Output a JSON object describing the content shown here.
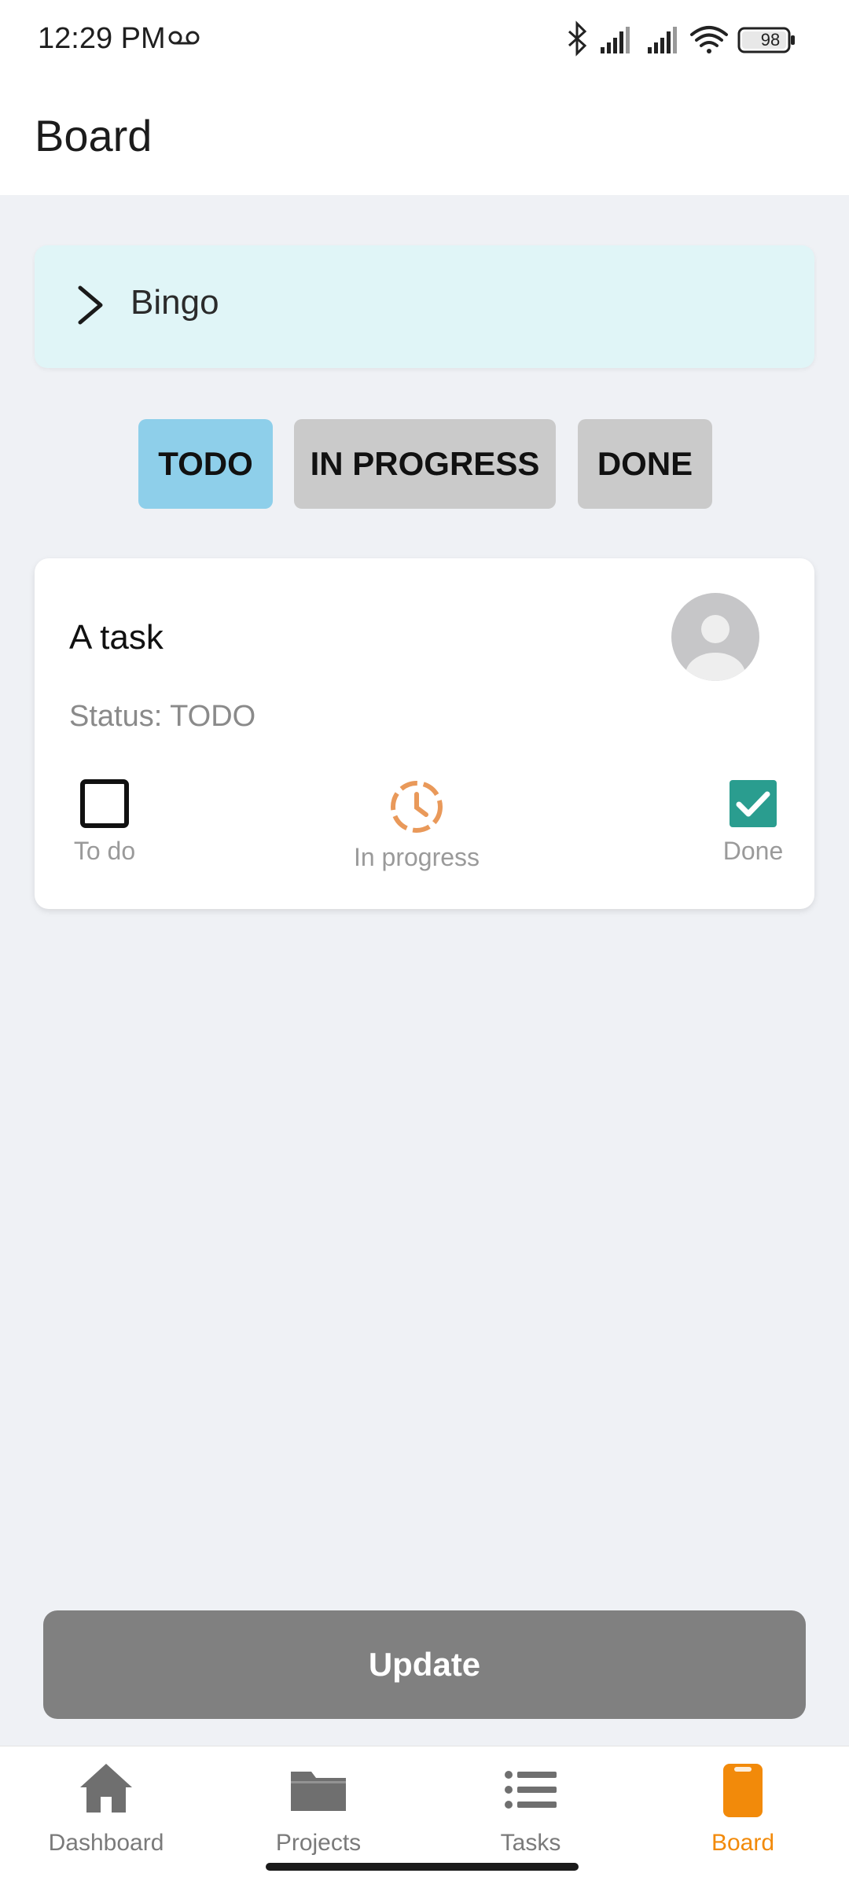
{
  "status_bar": {
    "time": "12:29 PM",
    "battery": "98",
    "icons": [
      "voicemail-icon",
      "bluetooth-icon",
      "signal-icon",
      "signal-icon",
      "wifi-icon",
      "battery-icon"
    ]
  },
  "app_bar": {
    "title": "Board"
  },
  "project": {
    "name": "Bingo",
    "icon": "chevron-right-icon"
  },
  "tabs": [
    {
      "label": "TODO",
      "selected": true
    },
    {
      "label": "IN PROGRESS",
      "selected": false
    },
    {
      "label": "DONE",
      "selected": false
    }
  ],
  "task": {
    "title": "A task",
    "status_text": "Status: TODO",
    "states": [
      {
        "label": "To do",
        "icon": "empty-checkbox-icon"
      },
      {
        "label": "In progress",
        "icon": "clock-icon"
      },
      {
        "label": "Done",
        "icon": "checked-checkbox-icon"
      }
    ]
  },
  "update_button": {
    "label": "Update"
  },
  "nav": [
    {
      "label": "Dashboard",
      "icon": "home-icon",
      "active": false
    },
    {
      "label": "Projects",
      "icon": "folder-icon",
      "active": false
    },
    {
      "label": "Tasks",
      "icon": "list-icon",
      "active": false
    },
    {
      "label": "Board",
      "icon": "clipboard-icon",
      "active": true
    }
  ],
  "colors": {
    "accent": "#f28a0a",
    "tab_selected": "#8ecfea",
    "tab_default": "#cacaca",
    "project_card": "#e0f5f7",
    "done_check": "#2a9d8f",
    "in_progress_clock": "#e9995a"
  }
}
